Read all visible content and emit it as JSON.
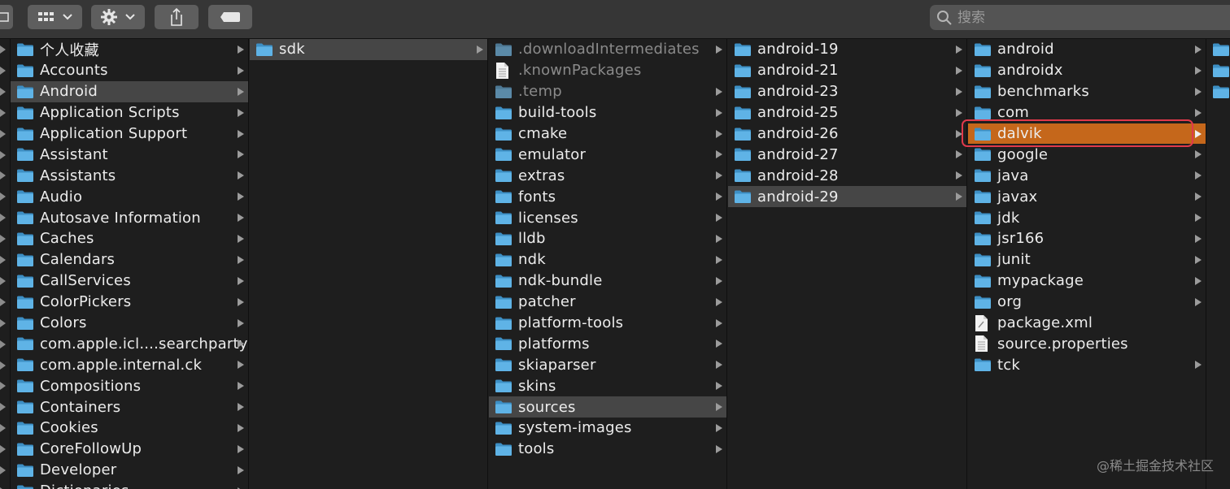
{
  "toolbar": {
    "search_placeholder": "搜索"
  },
  "columns": [
    {
      "items": [
        {
          "label": "个人收藏",
          "type": "folder",
          "arrow": true
        },
        {
          "label": "Accounts",
          "type": "folder",
          "arrow": true
        },
        {
          "label": "Android",
          "type": "folder",
          "arrow": true,
          "state": "selected"
        },
        {
          "label": "Application Scripts",
          "type": "folder",
          "arrow": true
        },
        {
          "label": "Application Support",
          "type": "folder",
          "arrow": true
        },
        {
          "label": "Assistant",
          "type": "folder",
          "arrow": true
        },
        {
          "label": "Assistants",
          "type": "folder",
          "arrow": true
        },
        {
          "label": "Audio",
          "type": "folder",
          "arrow": true
        },
        {
          "label": "Autosave Information",
          "type": "folder",
          "arrow": true
        },
        {
          "label": "Caches",
          "type": "folder",
          "arrow": true
        },
        {
          "label": "Calendars",
          "type": "folder",
          "arrow": true
        },
        {
          "label": "CallServices",
          "type": "folder",
          "arrow": true
        },
        {
          "label": "ColorPickers",
          "type": "folder",
          "arrow": true
        },
        {
          "label": "Colors",
          "type": "folder",
          "arrow": true
        },
        {
          "label": "com.apple.icl....searchpartyd",
          "type": "folder",
          "arrow": true
        },
        {
          "label": "com.apple.internal.ck",
          "type": "folder",
          "arrow": true
        },
        {
          "label": "Compositions",
          "type": "folder",
          "arrow": true
        },
        {
          "label": "Containers",
          "type": "folder",
          "arrow": true
        },
        {
          "label": "Cookies",
          "type": "folder",
          "arrow": true
        },
        {
          "label": "CoreFollowUp",
          "type": "folder",
          "arrow": true
        },
        {
          "label": "Developer",
          "type": "folder",
          "arrow": true
        },
        {
          "label": "Dictionaries",
          "type": "folder",
          "arrow": true
        }
      ]
    },
    {
      "items": [
        {
          "label": "sdk",
          "type": "folder",
          "arrow": true,
          "state": "selected"
        }
      ]
    },
    {
      "items": [
        {
          "label": ".downloadIntermediates",
          "type": "folder",
          "arrow": true,
          "dim": true
        },
        {
          "label": ".knownPackages",
          "type": "file",
          "arrow": false,
          "dim": true
        },
        {
          "label": ".temp",
          "type": "folder",
          "arrow": true,
          "dim": true
        },
        {
          "label": "build-tools",
          "type": "folder",
          "arrow": true
        },
        {
          "label": "cmake",
          "type": "folder",
          "arrow": true
        },
        {
          "label": "emulator",
          "type": "folder",
          "arrow": true
        },
        {
          "label": "extras",
          "type": "folder",
          "arrow": true
        },
        {
          "label": "fonts",
          "type": "folder",
          "arrow": true
        },
        {
          "label": "licenses",
          "type": "folder",
          "arrow": true
        },
        {
          "label": "lldb",
          "type": "folder",
          "arrow": true
        },
        {
          "label": "ndk",
          "type": "folder",
          "arrow": true
        },
        {
          "label": "ndk-bundle",
          "type": "folder",
          "arrow": true
        },
        {
          "label": "patcher",
          "type": "folder",
          "arrow": true
        },
        {
          "label": "platform-tools",
          "type": "folder",
          "arrow": true
        },
        {
          "label": "platforms",
          "type": "folder",
          "arrow": true
        },
        {
          "label": "skiaparser",
          "type": "folder",
          "arrow": true
        },
        {
          "label": "skins",
          "type": "folder",
          "arrow": true
        },
        {
          "label": "sources",
          "type": "folder",
          "arrow": true,
          "state": "selected"
        },
        {
          "label": "system-images",
          "type": "folder",
          "arrow": true
        },
        {
          "label": "tools",
          "type": "folder",
          "arrow": true
        }
      ]
    },
    {
      "items": [
        {
          "label": "android-19",
          "type": "folder",
          "arrow": true
        },
        {
          "label": "android-21",
          "type": "folder",
          "arrow": true
        },
        {
          "label": "android-23",
          "type": "folder",
          "arrow": true
        },
        {
          "label": "android-25",
          "type": "folder",
          "arrow": true
        },
        {
          "label": "android-26",
          "type": "folder",
          "arrow": true
        },
        {
          "label": "android-27",
          "type": "folder",
          "arrow": true
        },
        {
          "label": "android-28",
          "type": "folder",
          "arrow": true
        },
        {
          "label": "android-29",
          "type": "folder",
          "arrow": true,
          "state": "selected"
        }
      ]
    },
    {
      "items": [
        {
          "label": "android",
          "type": "folder",
          "arrow": true
        },
        {
          "label": "androidx",
          "type": "folder",
          "arrow": true
        },
        {
          "label": "benchmarks",
          "type": "folder",
          "arrow": true
        },
        {
          "label": "com",
          "type": "folder",
          "arrow": true
        },
        {
          "label": "dalvik",
          "type": "folder",
          "arrow": true,
          "state": "highlighted"
        },
        {
          "label": "google",
          "type": "folder",
          "arrow": true
        },
        {
          "label": "java",
          "type": "folder",
          "arrow": true
        },
        {
          "label": "javax",
          "type": "folder",
          "arrow": true
        },
        {
          "label": "jdk",
          "type": "folder",
          "arrow": true
        },
        {
          "label": "jsr166",
          "type": "folder",
          "arrow": true
        },
        {
          "label": "junit",
          "type": "folder",
          "arrow": true
        },
        {
          "label": "mypackage",
          "type": "folder",
          "arrow": true
        },
        {
          "label": "org",
          "type": "folder",
          "arrow": true
        },
        {
          "label": "package.xml",
          "type": "xml-file",
          "arrow": false
        },
        {
          "label": "source.properties",
          "type": "file",
          "arrow": false
        },
        {
          "label": "tck",
          "type": "folder",
          "arrow": true
        }
      ]
    },
    {
      "items": [
        {
          "label": "",
          "type": "folder",
          "arrow": false
        },
        {
          "label": "",
          "type": "folder",
          "arrow": false
        },
        {
          "label": "",
          "type": "folder",
          "arrow": false
        }
      ]
    }
  ],
  "colors": {
    "folder_blue": "#5fb3e6",
    "highlight_orange": "#c5671b",
    "annotation_red": "#e0394b"
  },
  "watermark": "@稀土掘金技术社区"
}
